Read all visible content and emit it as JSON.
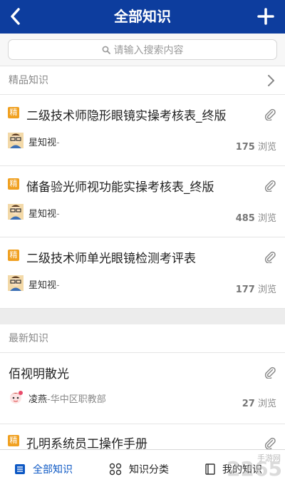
{
  "header": {
    "title": "全部知识"
  },
  "search": {
    "placeholder": "请输入搜索内容"
  },
  "featured": {
    "label": "精品知识",
    "items": [
      {
        "badge": "精",
        "title": "二级技术师隐形眼镜实操考核表_终版",
        "author": "星知视",
        "org": "-",
        "views": "175",
        "views_unit": "浏览"
      },
      {
        "badge": "精",
        "title": "储备验光师视功能实操考核表_终版",
        "author": "星知视",
        "org": "-",
        "views": "485",
        "views_unit": "浏览"
      },
      {
        "badge": "精",
        "title": "二级技术师单光眼镜检测考评表",
        "author": "星知视",
        "org": "-",
        "views": "177",
        "views_unit": "浏览"
      }
    ]
  },
  "latest": {
    "label": "最新知识",
    "items": [
      {
        "title": "佰视明散光",
        "author": "凌燕",
        "org": "-华中区职教部",
        "views": "27",
        "views_unit": "浏览"
      },
      {
        "badge": "精",
        "title": "孔明系统员工操作手册"
      }
    ]
  },
  "tabs": [
    {
      "label": "全部知识",
      "active": true
    },
    {
      "label": "知识分类",
      "active": false
    },
    {
      "label": "我的知识",
      "active": false
    }
  ],
  "watermark": {
    "text": "2265",
    "sub": "手游网"
  },
  "colors": {
    "header": "#0d3d9e",
    "accent": "#0d58c4",
    "badge": "#f0a020"
  }
}
